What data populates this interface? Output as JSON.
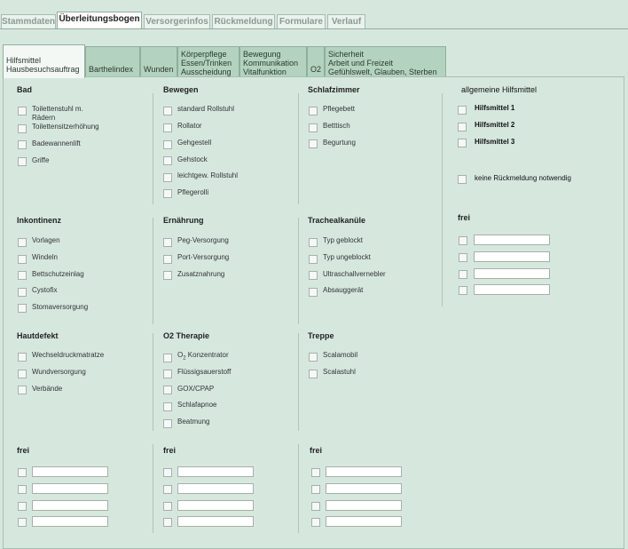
{
  "top_tabs": [
    "Stammdaten",
    "Überleitungsbogen",
    "Versorgerinfos",
    "Rückmeldung",
    "Formulare",
    "Verlauf"
  ],
  "sub_tabs": [
    [
      "Hilfsmittel",
      "Hausbesuchsauftrag"
    ],
    [
      "Barthelindex"
    ],
    [
      "Wunden"
    ],
    [
      "Körperpflege",
      "Essen/Trinken",
      "Ausscheidung"
    ],
    [
      "Bewegung",
      "Kommunikation",
      "Vitalfunktion"
    ],
    [
      "O2"
    ],
    [
      "Sicherheit",
      "Arbeit und Freizeit",
      "Gefühlswelt, Glauben, Sterben"
    ]
  ],
  "sections": {
    "bad": {
      "title": "Bad",
      "items": [
        "Toilettenstuhl m.",
        "Rädern",
        "Toilettensitzerhöhung",
        "Badewannenlift",
        "Griffe"
      ]
    },
    "bewegen": {
      "title": "Bewegen",
      "items": [
        "standard Rollstuhl",
        "Rollator",
        "Gehgestell",
        "Gehstock",
        "leichtgew. Rollstuhl",
        "Pflegerolli"
      ]
    },
    "schlafzimmer": {
      "title": "Schlafzimmer",
      "items": [
        "Pflegebett",
        "Betttisch",
        "Begurtung"
      ]
    },
    "allgemein": {
      "title": "allgemeine Hilfsmittel",
      "items": [
        "Hilfsmittel 1",
        "Hilfsmittel 2",
        "Hilfsmittel 3"
      ],
      "extra": "keine Rückmeldung notwendig"
    },
    "inkontinenz": {
      "title": "Inkontinenz",
      "items": [
        "Vorlagen",
        "Windeln",
        "Bettschutzeinlag",
        "Cystofix",
        "Stomaversorgung"
      ]
    },
    "ernaehrung": {
      "title": "Ernährung",
      "items": [
        "Peg-Versorgung",
        "Port-Versorgung",
        "Zusatznahrung"
      ]
    },
    "tracheal": {
      "title": "Trachealkanüle",
      "items": [
        "Typ geblockt",
        "Typ ungeblockt",
        "Ultraschallvernebler",
        "Absauggerät"
      ]
    },
    "frei": {
      "title": "frei"
    },
    "hautdefekt": {
      "title": "Hautdefekt",
      "items": [
        "Wechseldruckmatratze",
        "Wundversorgung",
        "Verbände"
      ]
    },
    "o2": {
      "title": "O2 Therapie",
      "items": [
        "O",
        "2",
        " Konzentrator",
        "Flüssigsauerstoff",
        "GOX/CPAP",
        "Schlafapnoe",
        "Beatmung"
      ]
    },
    "treppe": {
      "title": "Treppe",
      "items": [
        "Scalamobil",
        "Scalastuhl"
      ]
    }
  }
}
